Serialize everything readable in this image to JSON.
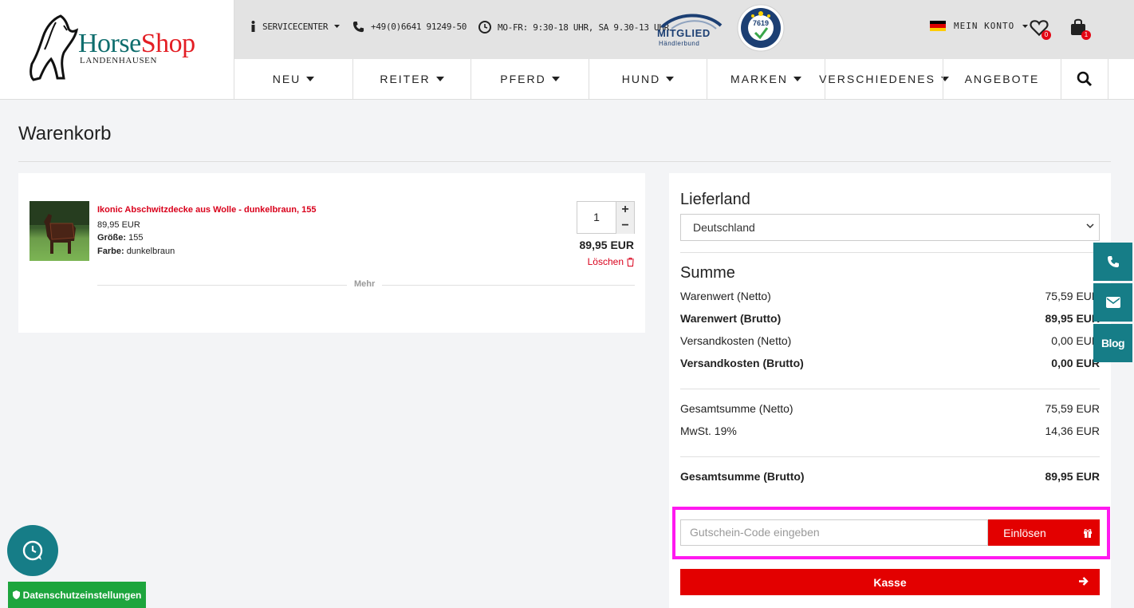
{
  "header": {
    "logo": {
      "word1": "Horse",
      "word2": "Shop",
      "subtitle": "LANDENHAUSEN"
    },
    "topbar": {
      "servicecenter": "SERVICECENTER",
      "phone": "+49(0)6641 91249-50",
      "hours": "MO-FR: 9:30-18 UHR, SA 9.30-13 UHR",
      "mitglied": "MITGLIED",
      "mitglied_sub": "Händlerbund",
      "trust_number": "7619",
      "account": "MEIN KONTO",
      "wishlist_count": "0",
      "cart_count": "1"
    },
    "nav": [
      {
        "label": "NEU",
        "dropdown": true
      },
      {
        "label": "REITER",
        "dropdown": true
      },
      {
        "label": "PFERD",
        "dropdown": true
      },
      {
        "label": "HUND",
        "dropdown": true
      },
      {
        "label": "MARKEN",
        "dropdown": true
      },
      {
        "label": "VERSCHIEDENES",
        "dropdown": true
      },
      {
        "label": "ANGEBOTE",
        "dropdown": false
      }
    ]
  },
  "page": {
    "title": "Warenkorb"
  },
  "cart": {
    "item": {
      "name": "Ikonic Abschwitzdecke aus Wolle - dunkelbraun, 155",
      "unit_price": "89,95 EUR",
      "size_label": "Größe:",
      "size": "155",
      "color_label": "Farbe:",
      "color": "dunkelbraun",
      "quantity": "1",
      "total": "89,95 EUR",
      "delete_label": "Löschen"
    },
    "more_label": "Mehr"
  },
  "summary": {
    "country_heading": "Lieferland",
    "country_value": "Deutschland",
    "sum_heading": "Summe",
    "rows": [
      {
        "label": "Warenwert (Netto)",
        "value": "75,59 EUR"
      },
      {
        "label": "Warenwert (Brutto)",
        "value": "89,95 EUR"
      },
      {
        "label": "Versandkosten (Netto)",
        "value": "0,00 EUR"
      },
      {
        "label": "Versandkosten (Brutto)",
        "value": "0,00 EUR"
      },
      {
        "label": "Gesamtsumme (Netto)",
        "value": "75,59 EUR"
      },
      {
        "label": "MwSt. 19%",
        "value": "14,36 EUR"
      },
      {
        "label": "Gesamtsumme (Brutto)",
        "value": "89,95 EUR"
      }
    ],
    "coupon_placeholder": "Gutschein-Code eingeben",
    "coupon_button": "Einlösen",
    "checkout_button": "Kasse"
  },
  "side": {
    "blog_label": "Blog"
  },
  "privacy_label": "Datenschutzeinstellungen",
  "colors": {
    "accent_red": "#e30000",
    "teal": "#167d87",
    "green": "#1da53d",
    "highlight": "#ff19f0"
  }
}
